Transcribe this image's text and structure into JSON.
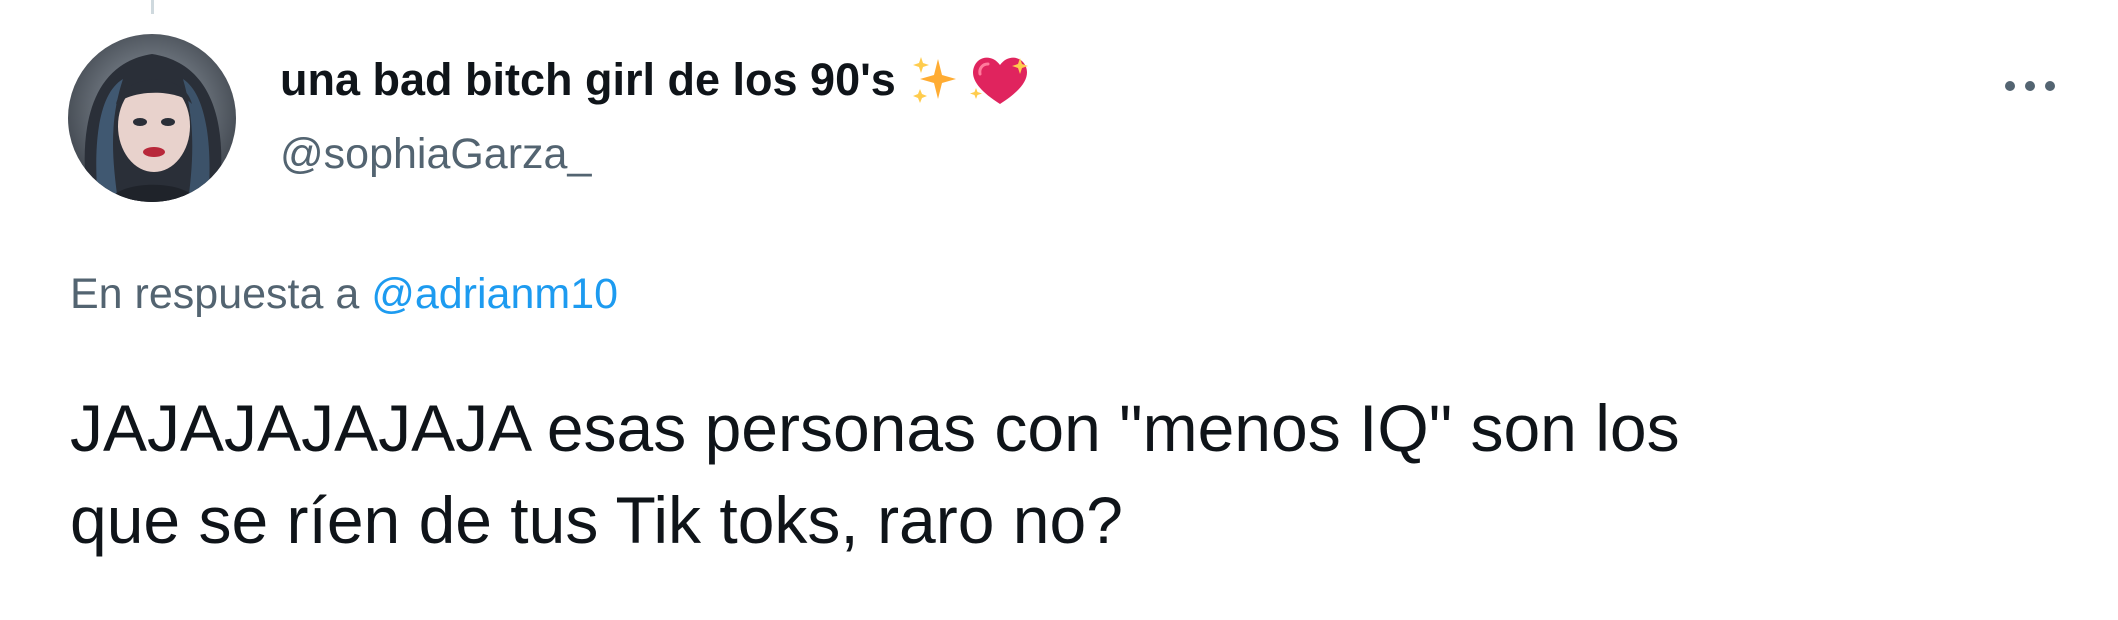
{
  "tweet": {
    "author": {
      "display_name": "una bad bitch girl de los 90's",
      "name_emojis": [
        "sparkles-icon",
        "heart-with-sparkles-icon"
      ],
      "handle": "@sophiaGarza_"
    },
    "more_button_icon": "more-horizontal-icon",
    "reply": {
      "prefix": "En respuesta a",
      "mention": "@adrianm10"
    },
    "text": "JAJAJAJAJAJA esas personas con \"menos IQ\" son los\nque se ríen de tus Tik toks, raro no?"
  },
  "colors": {
    "primary_text": "#0f1419",
    "secondary_text": "#536471",
    "mention_link": "#1d9bf0",
    "heart": "#e0245e",
    "sparkles": "#ffac33"
  }
}
